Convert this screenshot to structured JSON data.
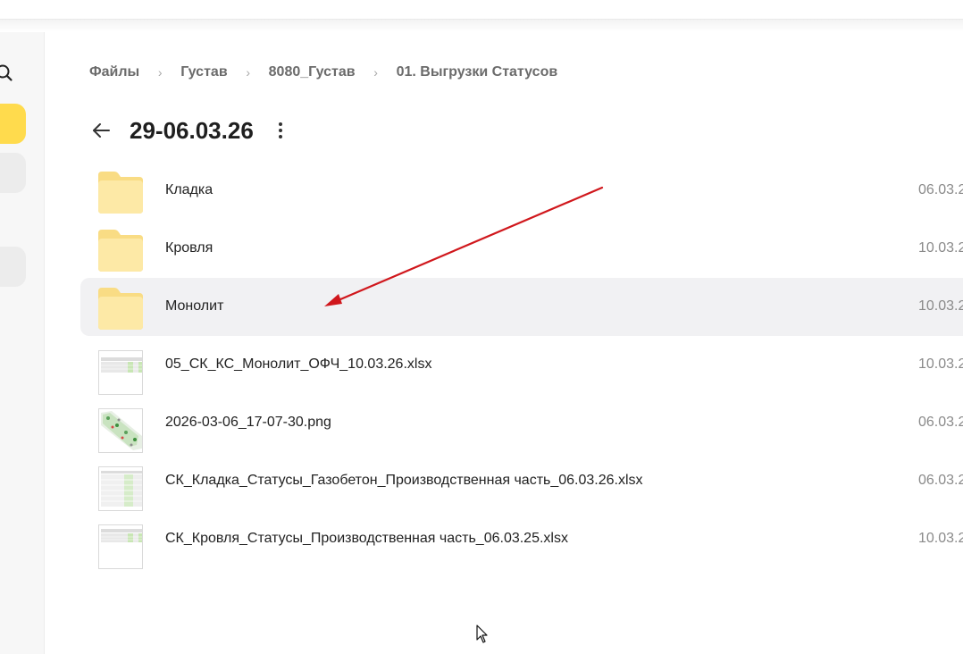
{
  "breadcrumb": {
    "items": [
      "Файлы",
      "Густав",
      "8080_Густав",
      "01. Выгрузки Статусов"
    ],
    "separator": "›"
  },
  "folder": {
    "title": "29-06.03.26"
  },
  "files": [
    {
      "name": "Кладка",
      "date": "06.03.2",
      "type": "folder"
    },
    {
      "name": "Кровля",
      "date": "10.03.2",
      "type": "folder"
    },
    {
      "name": "Монолит",
      "date": "10.03.2",
      "type": "folder",
      "selected": true
    },
    {
      "name": "05_СК_КС_Монолит_ОФЧ_10.03.26.xlsx",
      "date": "10.03.2",
      "type": "xlsx"
    },
    {
      "name": "2026-03-06_17-07-30.png",
      "date": "06.03.2",
      "type": "png"
    },
    {
      "name": "СК_Кладка_Статусы_Газобетон_Производственная часть_06.03.26.xlsx",
      "date": "06.03.2",
      "type": "xlsx"
    },
    {
      "name": "СК_Кровля_Статусы_Производственная часть_06.03.25.xlsx",
      "date": "10.03.2",
      "type": "xlsx"
    }
  ],
  "colors": {
    "accent": "#ffdb4d",
    "folder": "#fde9a6",
    "arrow": "#d0171c"
  }
}
